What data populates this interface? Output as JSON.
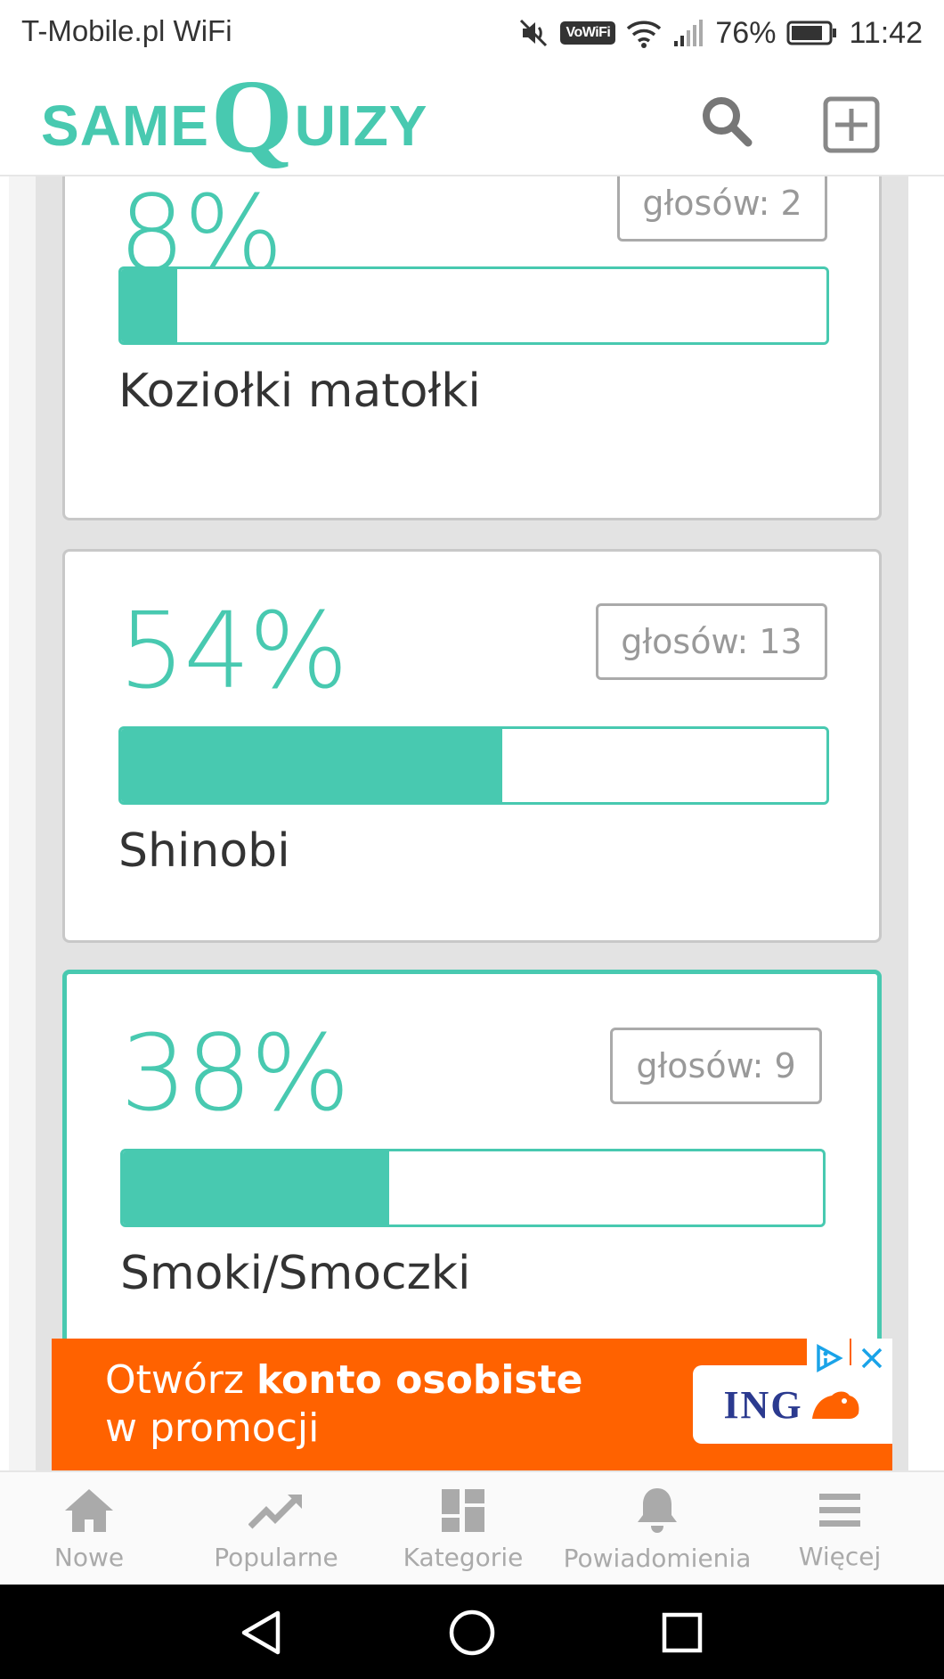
{
  "status_bar": {
    "carrier": "T-Mobile.pl WiFi",
    "vowifi_label": "VoWiFi",
    "battery_percent": "76%",
    "time": "11:42"
  },
  "header": {
    "logo_part1": "SAME",
    "logo_q": "Q",
    "logo_part2": "UIZY",
    "icons": [
      "search-icon",
      "add-icon"
    ]
  },
  "results": [
    {
      "percent": "8%",
      "votes_label": "głosów: 2",
      "fill_fraction": 0.08,
      "answer": "Koziołki matołki",
      "selected": false
    },
    {
      "percent": "54%",
      "votes_label": "głosów: 13",
      "fill_fraction": 0.54,
      "answer": "Shinobi",
      "selected": false
    },
    {
      "percent": "38%",
      "votes_label": "głosów: 9",
      "fill_fraction": 0.38,
      "answer": "Smoki/Smoczki",
      "selected": true
    }
  ],
  "ad": {
    "text_normal": "Otwórz ",
    "text_bold": "konto osobiste",
    "text_line2": "w promocji",
    "brand": "ING",
    "colors": {
      "background": "#ff6200",
      "brand": "#2b3a8f"
    }
  },
  "bottom_nav": {
    "items": [
      {
        "label": "Nowe",
        "icon": "home-icon"
      },
      {
        "label": "Popularne",
        "icon": "trending-icon"
      },
      {
        "label": "Kategorie",
        "icon": "categories-icon"
      },
      {
        "label": "Powiadomienia",
        "icon": "bell-icon"
      },
      {
        "label": "Więcej",
        "icon": "menu-icon"
      }
    ]
  },
  "colors": {
    "accent": "#48c9b0",
    "text": "#333333",
    "muted": "#aaaaaa"
  }
}
